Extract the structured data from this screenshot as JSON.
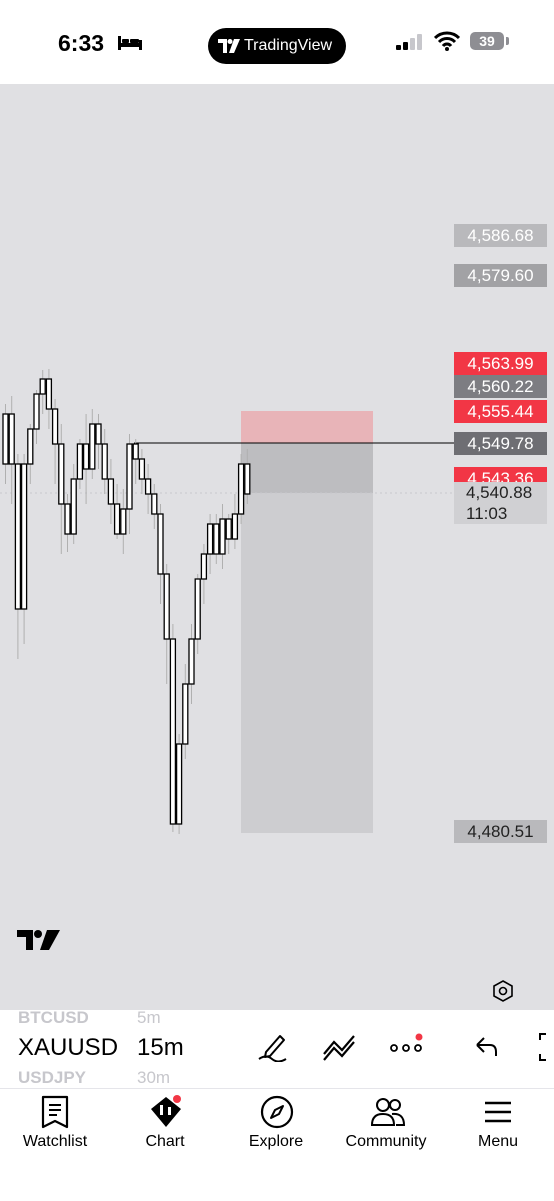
{
  "status_bar": {
    "time": "6:33",
    "app_pill": "TradingView",
    "battery": "39",
    "icons": [
      "bed-icon",
      "signal-icon",
      "wifi-icon",
      "battery-icon"
    ]
  },
  "chart": {
    "price_tags": [
      {
        "label": "4,586.68",
        "color": "#b9b9bc"
      },
      {
        "label": "4,579.60",
        "color": "#a2a2a5"
      },
      {
        "label": "4,563.99",
        "color": "#f23645"
      },
      {
        "label": "4,560.22",
        "color": "#7d7d82"
      },
      {
        "label": "4,555.44",
        "color": "#f23645"
      },
      {
        "label": "4,549.78",
        "color": "#6e6e73"
      },
      {
        "label": "4,543.36",
        "color": "#f23645"
      },
      {
        "label": "4,540.88",
        "color": "#d0d0d3"
      },
      {
        "label": "4,480.51",
        "color": "#b9b9bc"
      }
    ],
    "countdown": "11:03",
    "price_line": "4,549.78",
    "logo": "tradingview-logo",
    "settings_icon": "hexagon-settings-icon",
    "colors": {
      "background": "#e0e0e3",
      "stop_zone": "#e8b4b8",
      "target_zone": "#cdcdd0",
      "candle_body": "#ffffff",
      "candle_border": "#000000",
      "wick": "#b0b0b0"
    }
  },
  "toolbar": {
    "symbol_prev": "BTCUSD",
    "symbol": "XAUUSD",
    "symbol_next": "USDJPY",
    "interval_prev": "5m",
    "interval": "15m",
    "interval_next": "30m",
    "icons": [
      "pen-draw-icon",
      "trend-lines-icon",
      "more-dots-icon",
      "undo-icon",
      "fullscreen-icon"
    ]
  },
  "bottom_nav": {
    "items": [
      {
        "label": "Watchlist",
        "icon": "watchlist-icon"
      },
      {
        "label": "Chart",
        "icon": "chart-icon"
      },
      {
        "label": "Explore",
        "icon": "compass-icon"
      },
      {
        "label": "Community",
        "icon": "community-icon"
      },
      {
        "label": "Menu",
        "icon": "hamburger-menu-icon"
      }
    ]
  }
}
